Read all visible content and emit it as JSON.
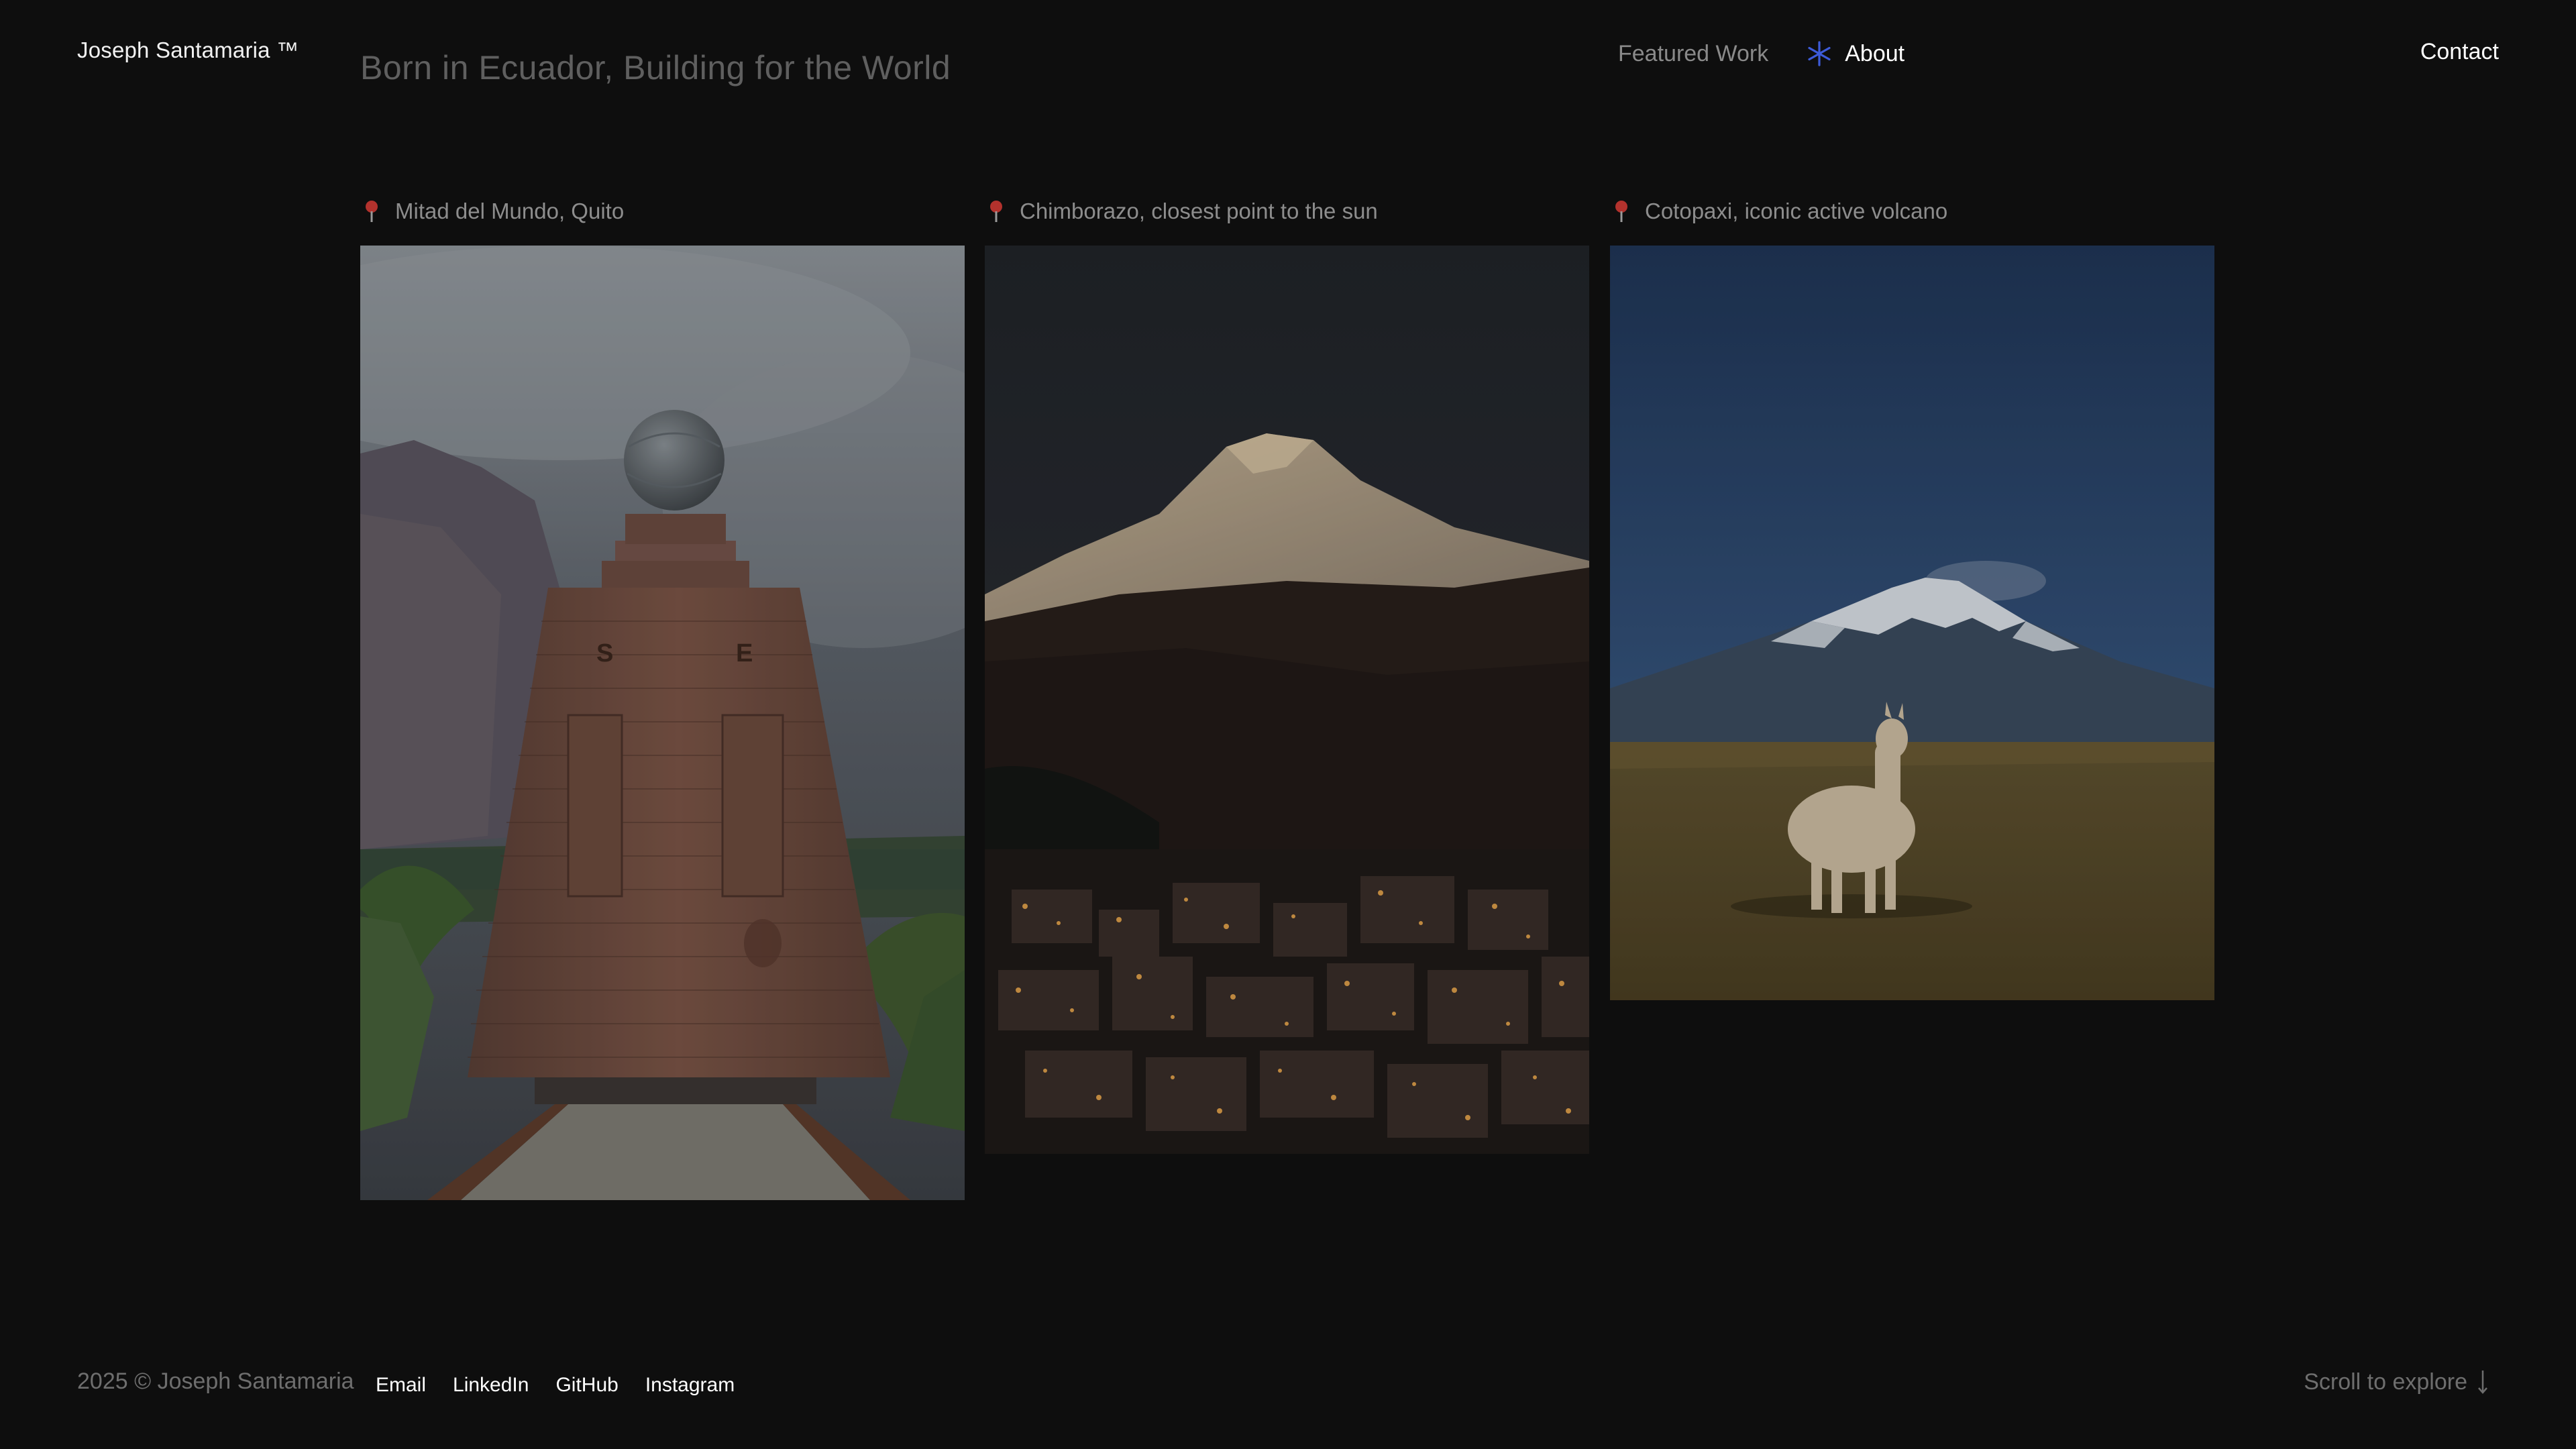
{
  "header": {
    "brand": "Joseph Santamaria ™",
    "headline": "Born in Ecuador, Building for the World",
    "nav": {
      "featured": "Featured Work",
      "about": "About",
      "about_icon": "asterisk-icon"
    },
    "contact": "Contact"
  },
  "gallery": [
    {
      "caption": "Mitad del Mundo, Quito",
      "icon": "pin-icon"
    },
    {
      "caption": "Chimborazo, closest point to the sun",
      "icon": "pin-icon"
    },
    {
      "caption": "Cotopaxi, iconic active volcano",
      "icon": "pin-icon"
    }
  ],
  "footer": {
    "copyright": "2025 © Joseph Santamaria",
    "links": [
      "Email",
      "LinkedIn",
      "GitHub",
      "Instagram"
    ],
    "scroll": "Scroll to explore",
    "scroll_icon": "arrow-down-icon"
  },
  "colors": {
    "background": "#0e0e0e",
    "accent": "#3d5bd9",
    "pin": "#b3322d"
  }
}
